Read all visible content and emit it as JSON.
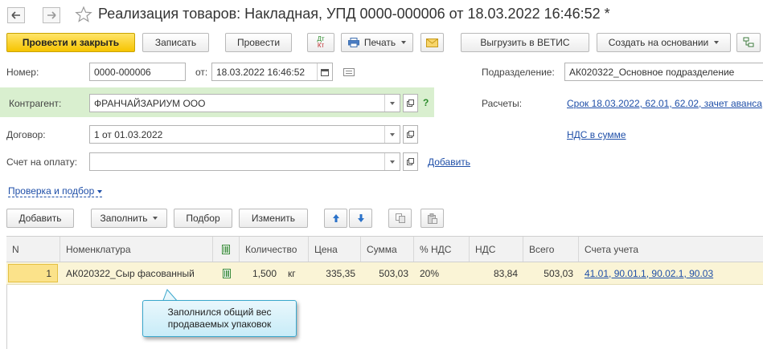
{
  "title": "Реализация товаров: Накладная, УПД 0000-000006 от 18.03.2022 16:46:52 *",
  "toolbar": {
    "post_close": "Провести и закрыть",
    "save": "Записать",
    "post": "Провести",
    "dtkt_top": "Дт",
    "dtkt_bottom": "Кт",
    "print": "Печать",
    "vetis": "Выгрузить в ВЕТИС",
    "create_based": "Создать на основании"
  },
  "form": {
    "number_label": "Номер:",
    "number_value": "0000-000006",
    "date_label": "от:",
    "date_value": "18.03.2022 16:46:52",
    "division_label": "Подразделение:",
    "division_value": "АК020322_Основное подразделение",
    "counterparty_label": "Контрагент:",
    "counterparty_value": "ФРАНЧАЙЗАРИУМ ООО",
    "help": "?",
    "settlements_label": "Расчеты:",
    "settlements_link": "Срок 18.03.2022, 62.01, 62.02, зачет аванса",
    "contract_label": "Договор:",
    "contract_value": "1 от 01.03.2022",
    "vat_link": "НДС в сумме",
    "invoice_label": "Счет на оплату:",
    "invoice_value": "",
    "add_link": "Добавить",
    "check_link": "Проверка и подбор"
  },
  "table_toolbar": {
    "add": "Добавить",
    "fill": "Заполнить",
    "selection": "Подбор",
    "change": "Изменить"
  },
  "table": {
    "columns": [
      "N",
      "Номенклатура",
      "Количество",
      "Цена",
      "Сумма",
      "% НДС",
      "НДС",
      "Всего",
      "Счета учета"
    ],
    "rows": [
      {
        "n": "1",
        "item": "АК020322_Сыр фасованный",
        "qty": "1,500",
        "unit": "кг",
        "price": "335,35",
        "sum": "503,03",
        "vat_rate": "20%",
        "vat": "83,84",
        "total": "503,03",
        "accounts": "41.01, 90.01.1, 90.02.1, 90.03"
      }
    ]
  },
  "callout": {
    "line1": "Заполнился общий вес",
    "line2": "продаваемых упаковок"
  },
  "colors": {
    "primary_button": "#f6c400",
    "link": "#1f4fa8",
    "counterparty_band": "#d9efcf",
    "selected_row": "#faf4d6",
    "callout_border": "#3aa7cc"
  }
}
